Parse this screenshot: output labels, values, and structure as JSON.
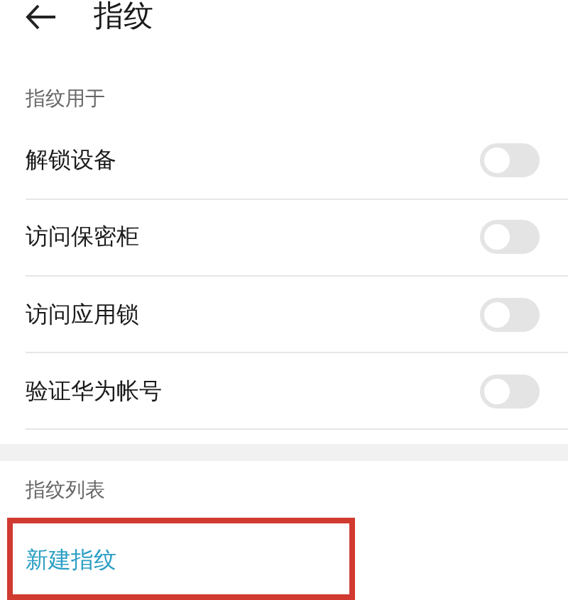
{
  "header": {
    "title": "指纹"
  },
  "usage_section": {
    "label": "指纹用于",
    "items": [
      {
        "label": "解锁设备",
        "on": false
      },
      {
        "label": "访问保密柜",
        "on": false
      },
      {
        "label": "访问应用锁",
        "on": false
      },
      {
        "label": "验证华为帐号",
        "on": false
      }
    ]
  },
  "list_section": {
    "label": "指纹列表",
    "new_item": {
      "label": "新建指纹",
      "highlighted": true
    }
  }
}
